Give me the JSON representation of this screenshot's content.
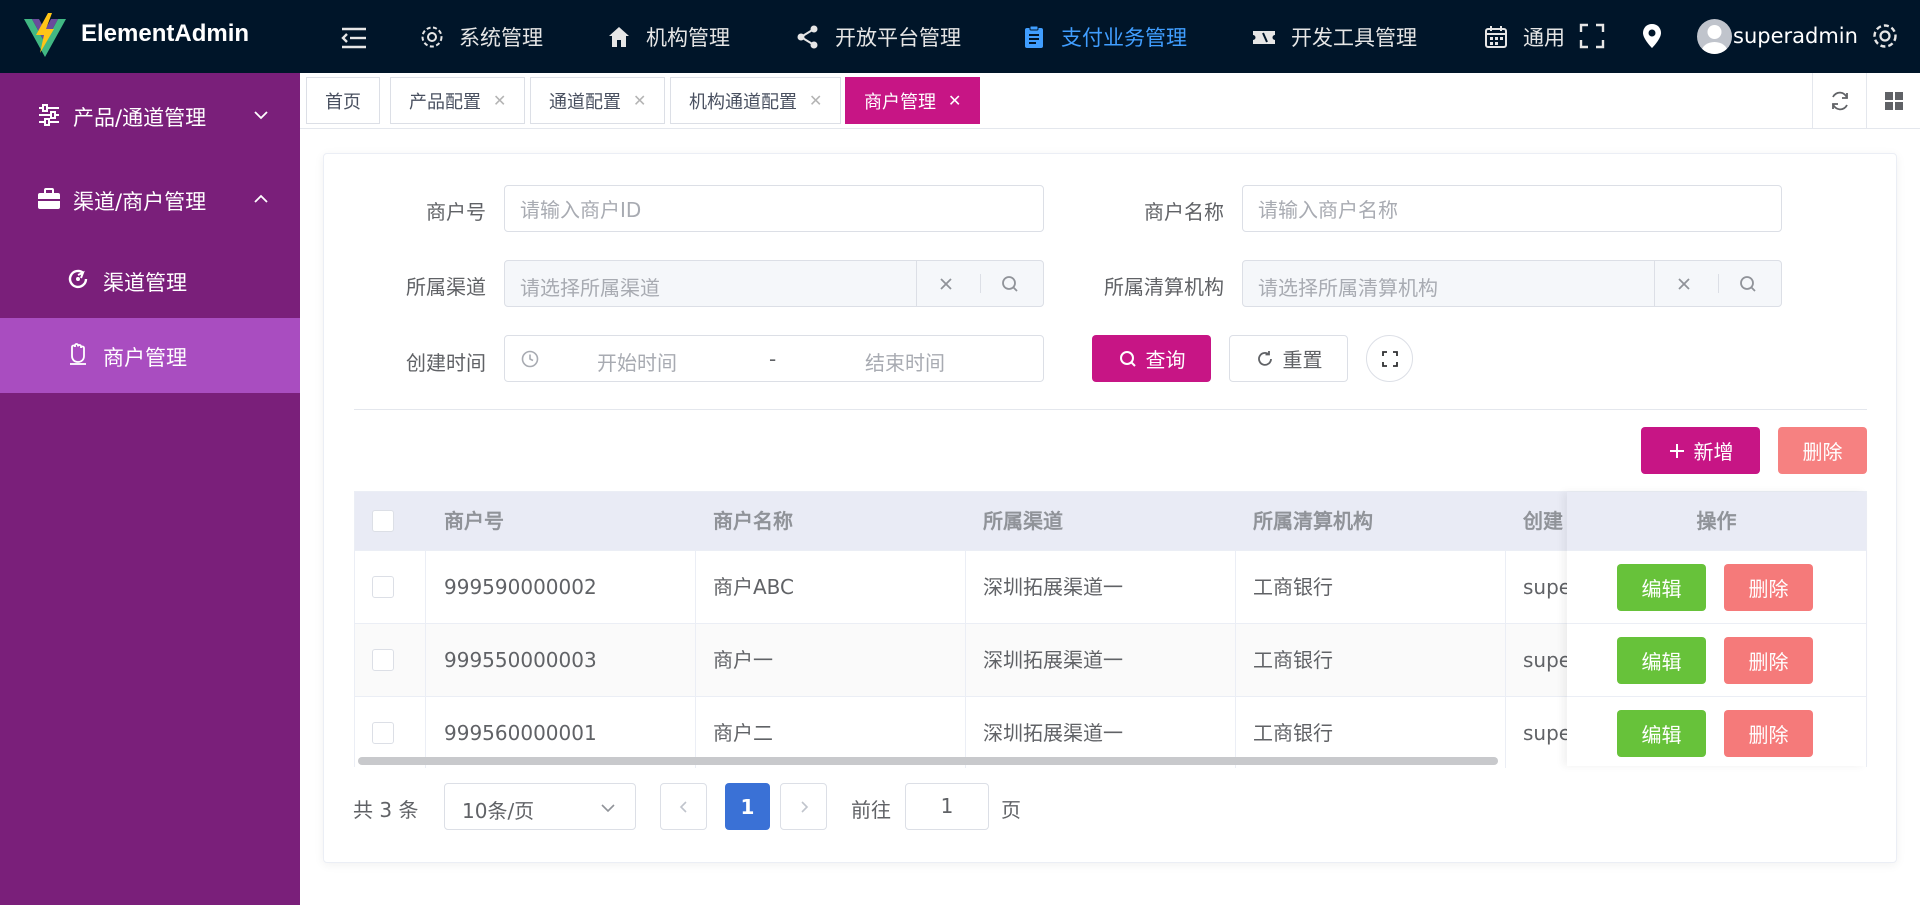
{
  "app": {
    "name": "ElementAdmin"
  },
  "colors": {
    "header_bg": "#001529",
    "sidebar_bg": "#7a1f7a",
    "sidebar_active": "#a94dc0",
    "accent": "#c71585",
    "nav_active": "#409eff",
    "success": "#67c23a",
    "danger": "#f56c6c",
    "page_active": "#3a71d6"
  },
  "topnav": {
    "items": [
      {
        "label": "系统管理",
        "icon": "gear-icon"
      },
      {
        "label": "机构管理",
        "icon": "home-icon"
      },
      {
        "label": "开放平台管理",
        "icon": "share-icon"
      },
      {
        "label": "支付业务管理",
        "icon": "clipboard-icon",
        "active": true
      },
      {
        "label": "开发工具管理",
        "icon": "ticket-icon"
      },
      {
        "label": "通用",
        "icon": "calendar-icon"
      }
    ],
    "username": "superadmin"
  },
  "sidebar": {
    "groups": [
      {
        "label": "产品/通道管理",
        "icon": "sliders-icon",
        "expanded": false
      },
      {
        "label": "渠道/商户管理",
        "icon": "briefcase-icon",
        "expanded": true
      }
    ],
    "subitems": [
      {
        "label": "渠道管理",
        "icon": "refresh-icon"
      },
      {
        "label": "商户管理",
        "icon": "hand-icon",
        "active": true
      }
    ]
  },
  "tags": [
    {
      "label": "首页"
    },
    {
      "label": "产品配置"
    },
    {
      "label": "通道配置"
    },
    {
      "label": "机构通道配置"
    },
    {
      "label": "商户管理",
      "active": true
    }
  ],
  "search": {
    "merchant_id_label": "商户号",
    "merchant_id_placeholder": "请输入商户ID",
    "merchant_name_label": "商户名称",
    "merchant_name_placeholder": "请输入商户名称",
    "channel_label": "所属渠道",
    "channel_placeholder": "请选择所属渠道",
    "clearing_label": "所属清算机构",
    "clearing_placeholder": "请选择所属清算机构",
    "created_label": "创建时间",
    "start_placeholder": "开始时间",
    "range_sep": "-",
    "end_placeholder": "结束时间",
    "query_label": "查询",
    "reset_label": "重置"
  },
  "toolbar": {
    "add_label": "新增",
    "delete_label": "删除"
  },
  "table": {
    "columns": [
      "商户号",
      "商户名称",
      "所属渠道",
      "所属清算机构",
      "创建",
      "操作"
    ],
    "rows": [
      {
        "id": "999590000002",
        "name": "商户ABC",
        "channel": "深圳拓展渠道一",
        "clearing": "工商银行",
        "creator": "supe"
      },
      {
        "id": "999550000003",
        "name": "商户一",
        "channel": "深圳拓展渠道一",
        "clearing": "工商银行",
        "creator": "supe"
      },
      {
        "id": "999560000001",
        "name": "商户二",
        "channel": "深圳拓展渠道一",
        "clearing": "工商银行",
        "creator": "supe"
      }
    ],
    "edit_label": "编辑",
    "delete_label": "删除"
  },
  "pagination": {
    "total": "共 3 条",
    "page_size": "10条/页",
    "current_page": "1",
    "goto_label": "前往",
    "goto_value": "1",
    "page_suffix": "页"
  }
}
